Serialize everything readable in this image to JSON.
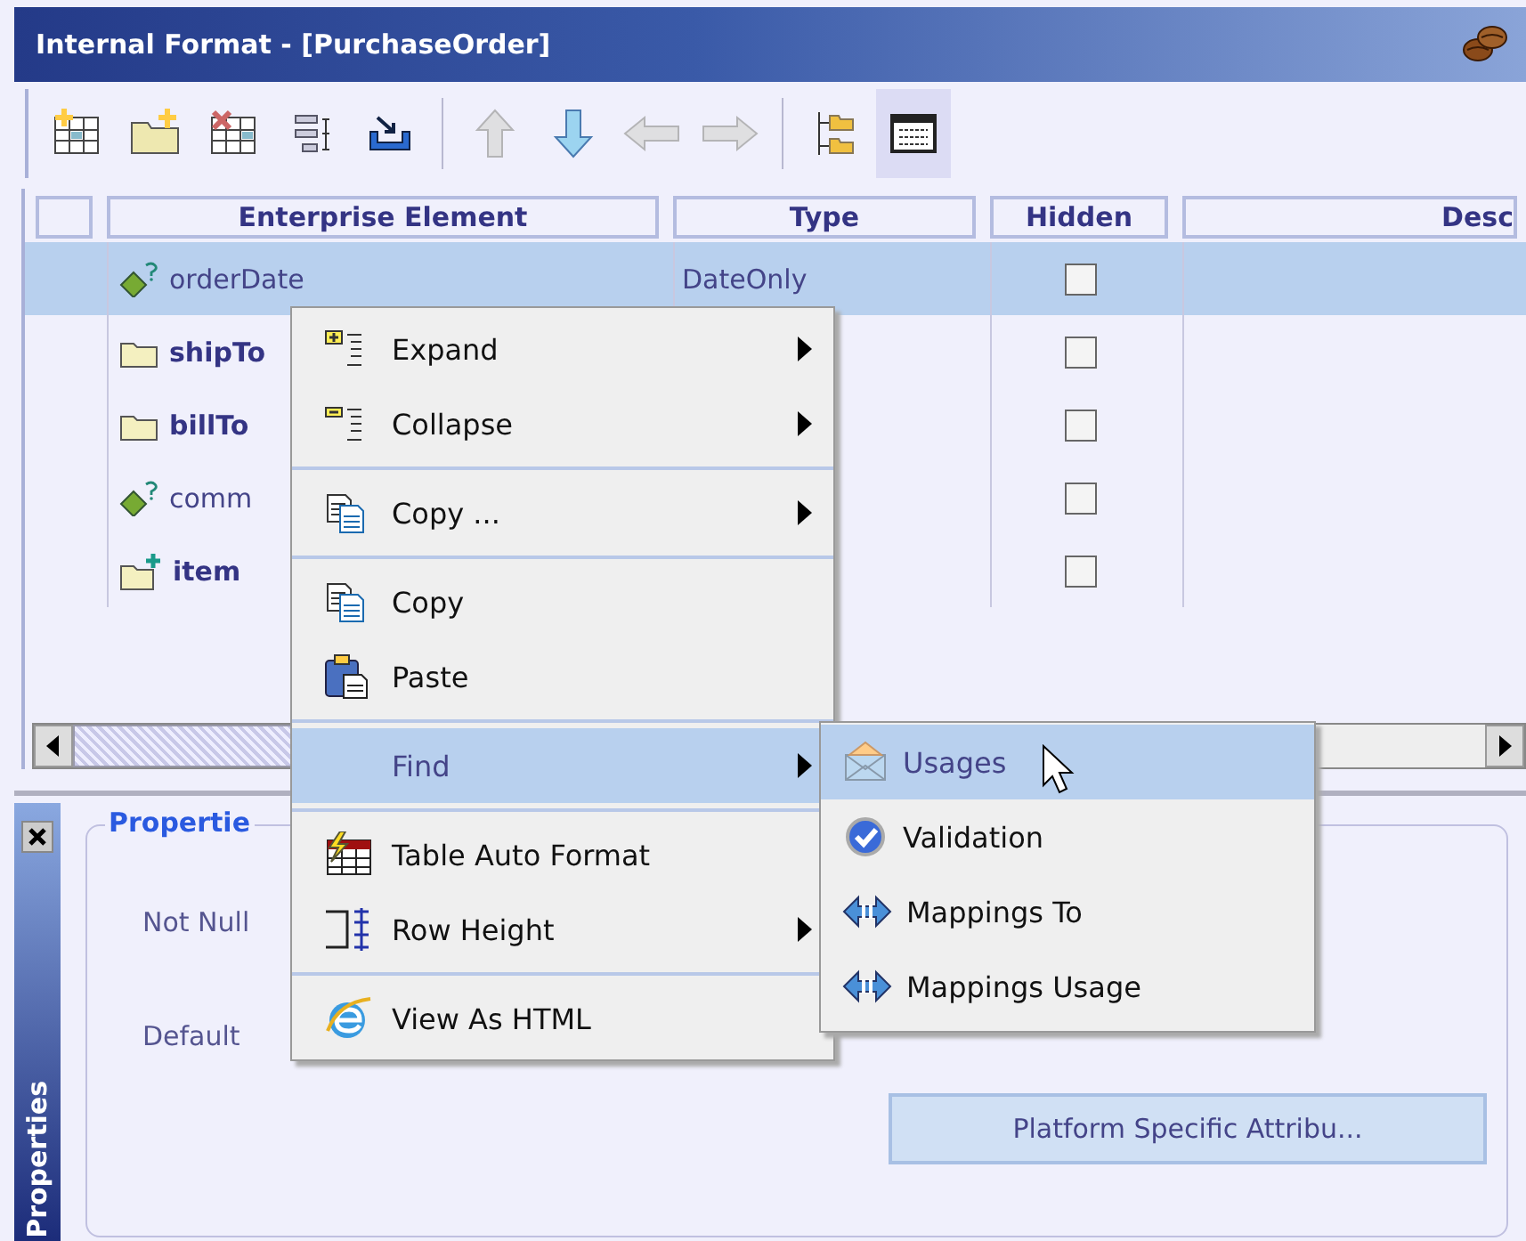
{
  "window": {
    "title": "Internal Format - [PurchaseOrder]"
  },
  "toolbar_groups": [
    {
      "tools": [
        {
          "kind": "table-add",
          "disabled": false,
          "selected": false
        },
        {
          "kind": "folder-add",
          "disabled": false,
          "selected": false
        },
        {
          "kind": "table-delete",
          "disabled": false,
          "selected": false
        },
        {
          "kind": "align",
          "disabled": false,
          "selected": false
        },
        {
          "kind": "import",
          "disabled": false,
          "selected": false
        }
      ]
    },
    {
      "tools": [
        {
          "kind": "up",
          "disabled": true,
          "selected": false
        },
        {
          "kind": "down",
          "disabled": false,
          "selected": false
        },
        {
          "kind": "left",
          "disabled": true,
          "selected": false
        },
        {
          "kind": "right",
          "disabled": true,
          "selected": false
        }
      ]
    },
    {
      "tools": [
        {
          "kind": "tree",
          "disabled": false,
          "selected": false
        },
        {
          "kind": "grid",
          "disabled": false,
          "selected": true
        }
      ]
    }
  ],
  "table": {
    "columns": [
      "Enterprise Element",
      "Type",
      "Hidden",
      "Desc"
    ],
    "rows": [
      {
        "name": "orderDate",
        "kind": "attribute",
        "type": "DateOnly",
        "hidden": false,
        "selected": true
      },
      {
        "name": "shipTo",
        "kind": "folder",
        "hidden": false,
        "selected": false
      },
      {
        "name": "billTo",
        "kind": "folder",
        "hidden": false,
        "selected": false
      },
      {
        "name": "comm",
        "kind": "attribute",
        "hidden": false,
        "selected": false
      },
      {
        "name": "item",
        "kind": "folder-new",
        "hidden": false,
        "selected": false
      }
    ]
  },
  "properties": {
    "tab": "Properties",
    "legend": "Propertie",
    "labels": [
      "Not Null",
      "Default"
    ],
    "button": "Platform Specific Attribu..."
  },
  "menu_groups": [
    {
      "items": [
        {
          "label": "Expand",
          "kind": "expand",
          "submenu": true,
          "selected": false
        },
        {
          "label": "Collapse",
          "kind": "collapse",
          "submenu": true,
          "selected": false
        }
      ]
    },
    {
      "items": [
        {
          "label": "Copy ...",
          "kind": "copy",
          "submenu": true,
          "selected": false
        }
      ]
    },
    {
      "items": [
        {
          "label": "Copy",
          "kind": "copy",
          "submenu": false,
          "selected": false
        },
        {
          "label": "Paste",
          "kind": "paste",
          "submenu": false,
          "selected": false
        }
      ]
    },
    {
      "items": [
        {
          "label": "Find",
          "kind": "plain",
          "submenu": true,
          "selected": true
        }
      ]
    },
    {
      "items": [
        {
          "label": "Table Auto Format",
          "kind": "table-format",
          "submenu": false,
          "selected": false
        },
        {
          "label": "Row Height",
          "kind": "row-height",
          "submenu": true,
          "selected": false
        }
      ]
    },
    {
      "items": [
        {
          "label": "View As HTML",
          "kind": "browser",
          "submenu": false,
          "selected": false
        }
      ]
    }
  ],
  "submenu": [
    {
      "label": "Usages",
      "kind": "envelope",
      "selected": true
    },
    {
      "label": "Validation",
      "kind": "check",
      "selected": false
    },
    {
      "label": "Mappings To",
      "kind": "mapping",
      "selected": false
    },
    {
      "label": "Mappings Usage",
      "kind": "mapping",
      "selected": false
    }
  ]
}
